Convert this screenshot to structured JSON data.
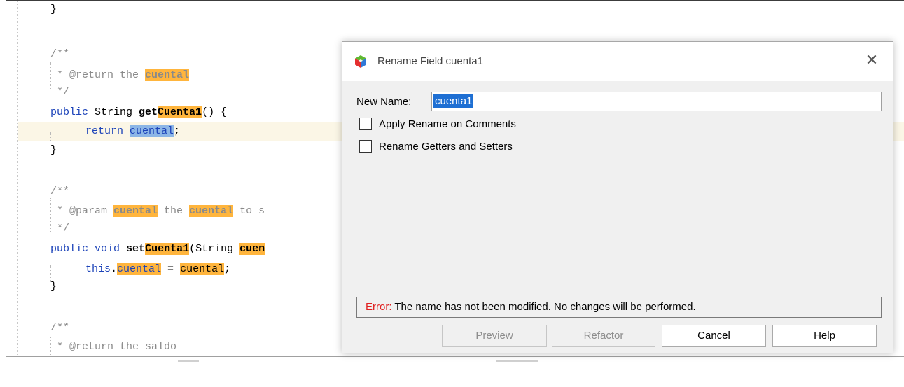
{
  "editor": {
    "lines": {
      "l1": "}",
      "l2": "/**",
      "l3_a": " * @return the ",
      "l3_b": "cuental",
      "l4": " */",
      "l5_kw": "public",
      "l5_a": " String ",
      "l5_b": "get",
      "l5_c": "Cuenta1",
      "l5_d": "() {",
      "l6_kw": "return",
      "l6_sp": " ",
      "l6_sel": "cuental",
      "l6_end": ";",
      "l7": "}",
      "l8": "/**",
      "l9_a": " * @param ",
      "l9_b": "cuental",
      "l9_c": " the ",
      "l9_d": "cuental",
      "l9_e": " to s",
      "l10": " */",
      "l11_kw": "public void",
      "l11_b": "set",
      "l11_c": "Cuenta1",
      "l11_d": "(String ",
      "l11_e": "cuen",
      "l12_kw": "this",
      "l12_dot": ".",
      "l12_b": "cuental",
      "l12_c": " = ",
      "l12_d": "cuental",
      "l12_e": ";",
      "l13": "}",
      "l14": "/**",
      "l15": " * @return the saldo"
    }
  },
  "dialog": {
    "title": "Rename Field cuenta1",
    "close_glyph": "✕",
    "new_name_label": "New Name:",
    "new_name_value": "cuenta1",
    "apply_rename_comments": "Apply Rename on Comments",
    "rename_getters_setters": "Rename Getters and Setters",
    "error_keyword": "Error:",
    "error_message": " The name has not been modified. No changes will be performed.",
    "buttons": {
      "preview": "Preview",
      "refactor": "Refactor",
      "cancel": "Cancel",
      "help": "Help"
    }
  },
  "colors": {
    "keyword": "#1c43b9",
    "comment": "#8a8a8a",
    "occurrence_highlight": "#ffb53d",
    "selection": "#8cb6e6",
    "error_red": "#e02020",
    "name_selection": "#1e6fd3"
  },
  "icons": {
    "app": "netbeans-cube-icon",
    "close": "close-icon",
    "checkbox": "checkbox-icon"
  }
}
